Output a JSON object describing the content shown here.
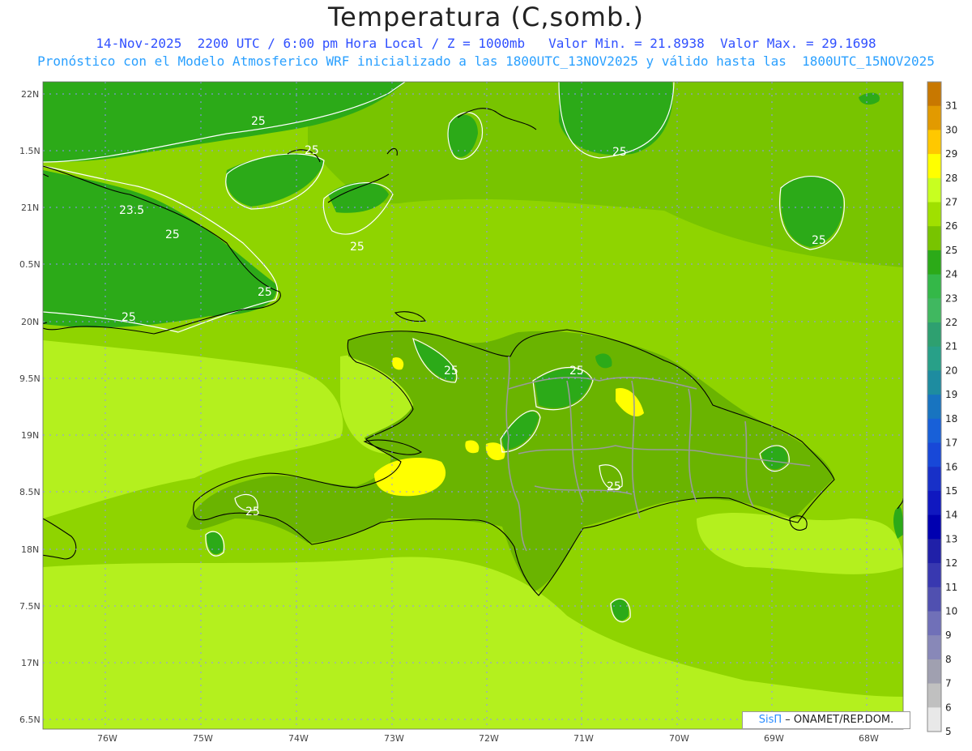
{
  "title": "Temperatura (C,somb.)",
  "subtitle_line1": "14-Nov-2025  2200 UTC / 6:00 pm Hora Local / Z = 1000mb   Valor Min. = 21.8938  Valor Max. = 29.1698",
  "subtitle_line2": "Pronóstico con el Modelo Atmosferico WRF inicializado a las 1800UTC_13NOV2025 y válido hasta las  1800UTC_15NOV2025",
  "credit": {
    "brand": "SisΠ",
    "text": " – ONAMET/REP.DOM."
  },
  "lat_labels": [
    "22N",
    "1.5N",
    "21N",
    "0.5N",
    "20N",
    "9.5N",
    "19N",
    "8.5N",
    "18N",
    "7.5N",
    "17N",
    "6.5N"
  ],
  "lon_labels": [
    "76W",
    "75W",
    "74W",
    "73W",
    "72W",
    "71W",
    "70W",
    "69W",
    "68W"
  ],
  "contour_labels": [
    "25",
    "25",
    "23.5",
    "25",
    "25",
    "25",
    "25",
    "25",
    "25",
    "25",
    "25",
    "25"
  ],
  "colorbar": {
    "labels": [
      "31",
      "30",
      "29",
      "28",
      "27",
      "26",
      "25",
      "24",
      "23",
      "22",
      "21",
      "20",
      "19",
      "18",
      "17",
      "16",
      "15",
      "14",
      "13",
      "12",
      "11",
      "10",
      "9",
      "8",
      "7",
      "6",
      "5"
    ],
    "colors": [
      "#c87800",
      "#e29a00",
      "#ffc800",
      "#ffff00",
      "#c8ff20",
      "#a0e000",
      "#78c400",
      "#2caa18",
      "#34b848",
      "#40b860",
      "#2ea070",
      "#28a088",
      "#1e8ca0",
      "#1874c0",
      "#1860d8",
      "#1848d8",
      "#1830c8",
      "#1018c0",
      "#0000b0",
      "#2020a8",
      "#3838b0",
      "#5050b0",
      "#7070b8",
      "#8888b8",
      "#a0a0b0",
      "#c0c0c0",
      "#e8e8e8"
    ]
  },
  "colors": {
    "sea_base": "#8fd400",
    "sea_warm": "#b4f01e",
    "cool_green": "#2caa18",
    "mid_green": "#6ab400",
    "warm_yellow": "#ffff00",
    "coast": "#000000",
    "border": "#9a9a9a"
  }
}
